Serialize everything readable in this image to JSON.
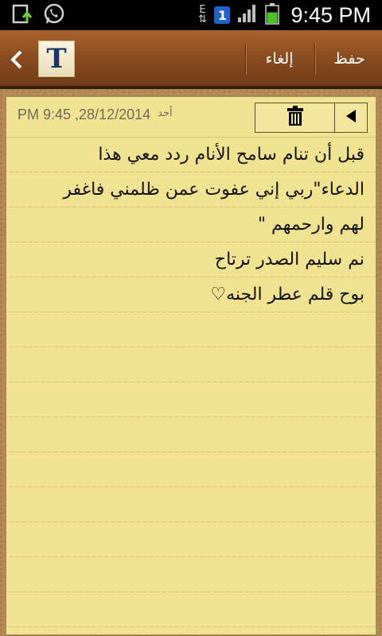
{
  "status_bar": {
    "time": "9:45 PM",
    "network_type": "E",
    "sim_number": "1",
    "icons": [
      "upload-notification-icon",
      "whatsapp-icon",
      "data-activity-icon",
      "sim-icon",
      "signal-icon",
      "battery-icon"
    ],
    "battery_level": 0.6
  },
  "action_bar": {
    "app_icon_letter": "T",
    "save_label": "حفظ",
    "cancel_label": "إلغاء",
    "colors": {
      "wood": "#8a4c20"
    }
  },
  "note": {
    "date": "PM 9:45 ,28/12/2014",
    "day": "أحد",
    "paper_color": "#f1e291",
    "lines": [
      "قبل أن تنام سامح الأنام ردد معي هذا",
      "الدعاء\"ربي إني عفوت عمن ظلمني فاغفر",
      "لهم وارحمهم \"",
      "نم سليم الصدر ترتاح",
      "بوح قلم عطر الجنه♡"
    ]
  }
}
